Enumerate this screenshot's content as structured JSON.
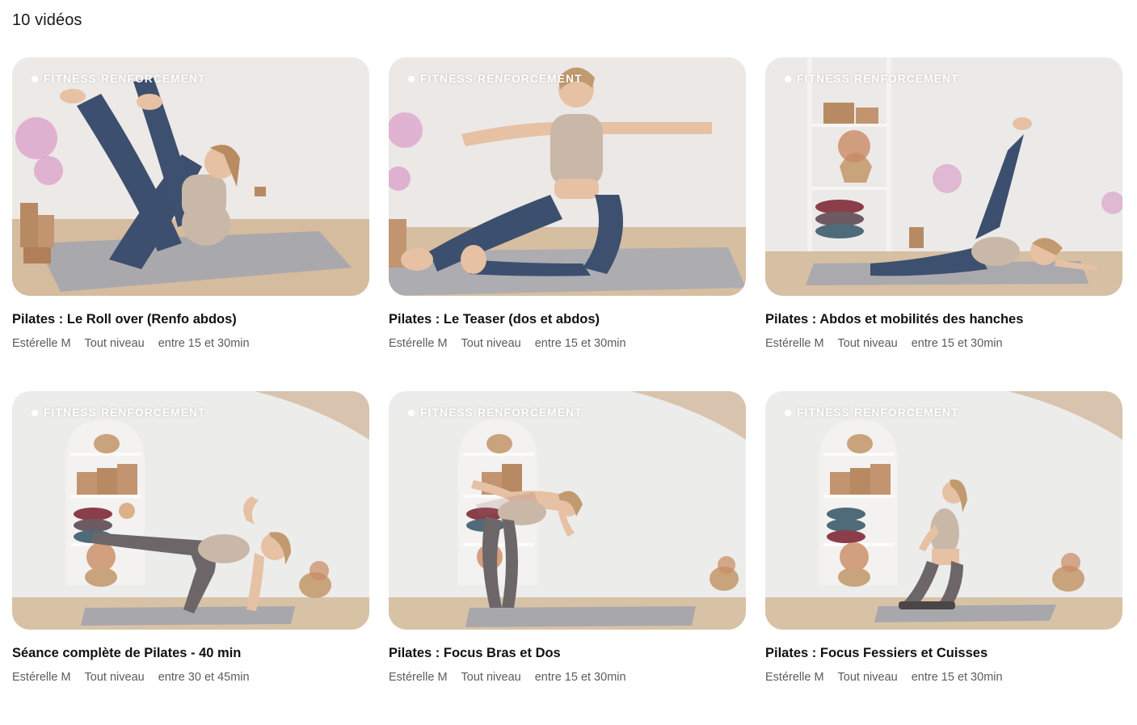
{
  "header": {
    "count_label": "10 vidéos"
  },
  "colors": {
    "wall": "#ebe8e5",
    "floor": "#d3b99a",
    "mat": "#a7a6ab",
    "leggings_blue": "#3c4f6e",
    "leggings_grey": "#6d6669",
    "top": "#c9b8a8",
    "skin": "#e6c1a4",
    "hair": "#b98b60",
    "wood_box": "#b88a63",
    "pink_flowers": "#d89ac6"
  },
  "videos": [
    {
      "category": "FITNESS RENFORCEMENT",
      "title": "Pilates : Le Roll over (Renfo abdos)",
      "instructor": "Estérelle M",
      "level": "Tout niveau",
      "duration": "entre 15 et 30min",
      "thumbnail_icon": "pilates-roll-over-thumbnail"
    },
    {
      "category": "FITNESS RENFORCEMENT",
      "title": "Pilates : Le Teaser (dos et abdos)",
      "instructor": "Estérelle M",
      "level": "Tout niveau",
      "duration": "entre 15 et 30min",
      "thumbnail_icon": "pilates-teaser-thumbnail"
    },
    {
      "category": "FITNESS RENFORCEMENT",
      "title": "Pilates : Abdos et mobilités des hanches",
      "instructor": "Estérelle M",
      "level": "Tout niveau",
      "duration": "entre 15 et 30min",
      "thumbnail_icon": "pilates-hip-mobility-thumbnail"
    },
    {
      "category": "FITNESS RENFORCEMENT",
      "title": "Séance complète de Pilates - 40 min",
      "instructor": "Estérelle M",
      "level": "Tout niveau",
      "duration": "entre 30 et 45min",
      "thumbnail_icon": "pilates-full-session-thumbnail"
    },
    {
      "category": "FITNESS RENFORCEMENT",
      "title": "Pilates : Focus Bras et Dos",
      "instructor": "Estérelle M",
      "level": "Tout niveau",
      "duration": "entre 15 et 30min",
      "thumbnail_icon": "pilates-arms-back-thumbnail"
    },
    {
      "category": "FITNESS RENFORCEMENT",
      "title": "Pilates : Focus Fessiers et Cuisses",
      "instructor": "Estérelle M",
      "level": "Tout niveau",
      "duration": "entre 15 et 30min",
      "thumbnail_icon": "pilates-glutes-thighs-thumbnail"
    }
  ]
}
